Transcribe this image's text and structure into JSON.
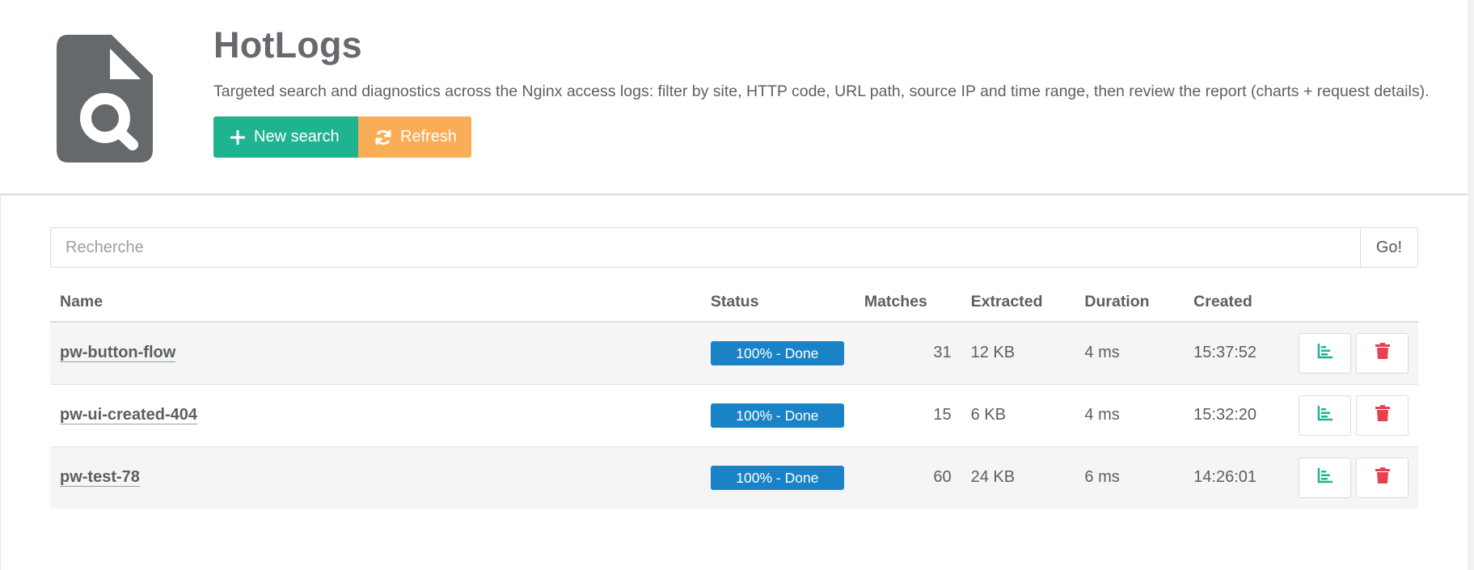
{
  "app": {
    "title": "HotLogs",
    "description": "Targeted search and diagnostics across the Nginx access logs: filter by site, HTTP code, URL path, source IP and time range, then review the report (charts + request details).",
    "logo_icon": "file-search-icon"
  },
  "toolbar": {
    "new_search_label": "New search",
    "new_search_icon": "plus-icon",
    "refresh_label": "Refresh",
    "refresh_icon": "refresh-icon"
  },
  "search": {
    "placeholder": "Recherche",
    "value": "",
    "go_label": "Go!"
  },
  "table": {
    "headers": {
      "name": "Name",
      "status": "Status",
      "matches": "Matches",
      "extracted": "Extracted",
      "duration": "Duration",
      "created": "Created"
    },
    "rows": [
      {
        "name": "pw-button-flow",
        "status": "100% - Done",
        "matches": "31",
        "extracted": "12 KB",
        "duration": "4 ms",
        "created": "15:37:52"
      },
      {
        "name": "pw-ui-created-404",
        "status": "100% - Done",
        "matches": "15",
        "extracted": "6 KB",
        "duration": "4 ms",
        "created": "15:32:20"
      },
      {
        "name": "pw-test-78",
        "status": "100% - Done",
        "matches": "60",
        "extracted": "24 KB",
        "duration": "6 ms",
        "created": "14:26:01"
      }
    ],
    "row_actions": [
      "bar-chart-icon",
      "trash-icon"
    ]
  },
  "colors": {
    "green": "#1fb38f",
    "orange": "#f8ad56",
    "status_blue": "#1a83c7",
    "danger": "#e5414e",
    "logo_gray": "#66696c"
  }
}
